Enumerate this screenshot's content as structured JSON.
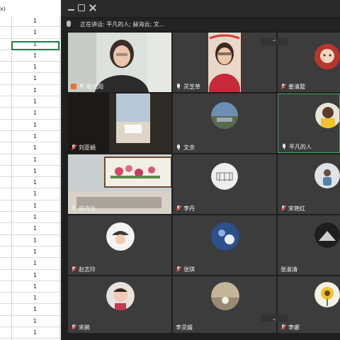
{
  "spreadsheet": {
    "header_text": "x)",
    "row_value": "1",
    "rows": [
      "1",
      "1",
      "1",
      "1",
      "1",
      "1",
      "1",
      "1",
      "1",
      "1",
      "1",
      "1",
      "1",
      "1",
      "1",
      "1",
      "1",
      "1",
      "1",
      "1",
      "1",
      "1",
      "1",
      "1",
      "1",
      "1",
      "1",
      "1"
    ]
  },
  "meeting": {
    "speaking_label": "正在讲话: 平凡的人; 赫海云; 文...",
    "participants": [
      {
        "name": "戴瑞阳",
        "icon": "host-icon"
      },
      {
        "name": "灵芝草",
        "icon": "mic-icon"
      },
      {
        "name": "姜清懿",
        "icon": "mic-muted-icon"
      },
      {
        "name": "刘亚娟",
        "icon": "mic-muted-icon"
      },
      {
        "name": "文余",
        "icon": "mic-icon"
      },
      {
        "name": "平凡的人",
        "icon": "mic-icon"
      },
      {
        "name": "赫海云",
        "icon": "mic-icon"
      },
      {
        "name": "李丹",
        "icon": "mic-muted-icon"
      },
      {
        "name": "宋艳红",
        "icon": "mic-muted-icon"
      },
      {
        "name": "赵志玲",
        "icon": "mic-muted-icon"
      },
      {
        "name": "张琪",
        "icon": "mic-muted-icon"
      },
      {
        "name": "张淑清",
        "icon": ""
      },
      {
        "name": "宋鹃",
        "icon": "mic-muted-icon"
      },
      {
        "name": "李灵婿",
        "icon": ""
      },
      {
        "name": "李娜",
        "icon": "mic-muted-icon"
      }
    ],
    "colors": {
      "active_border": "#3ea86a",
      "host_badge": "#e8742a",
      "mute_red": "#e24a4a"
    }
  }
}
